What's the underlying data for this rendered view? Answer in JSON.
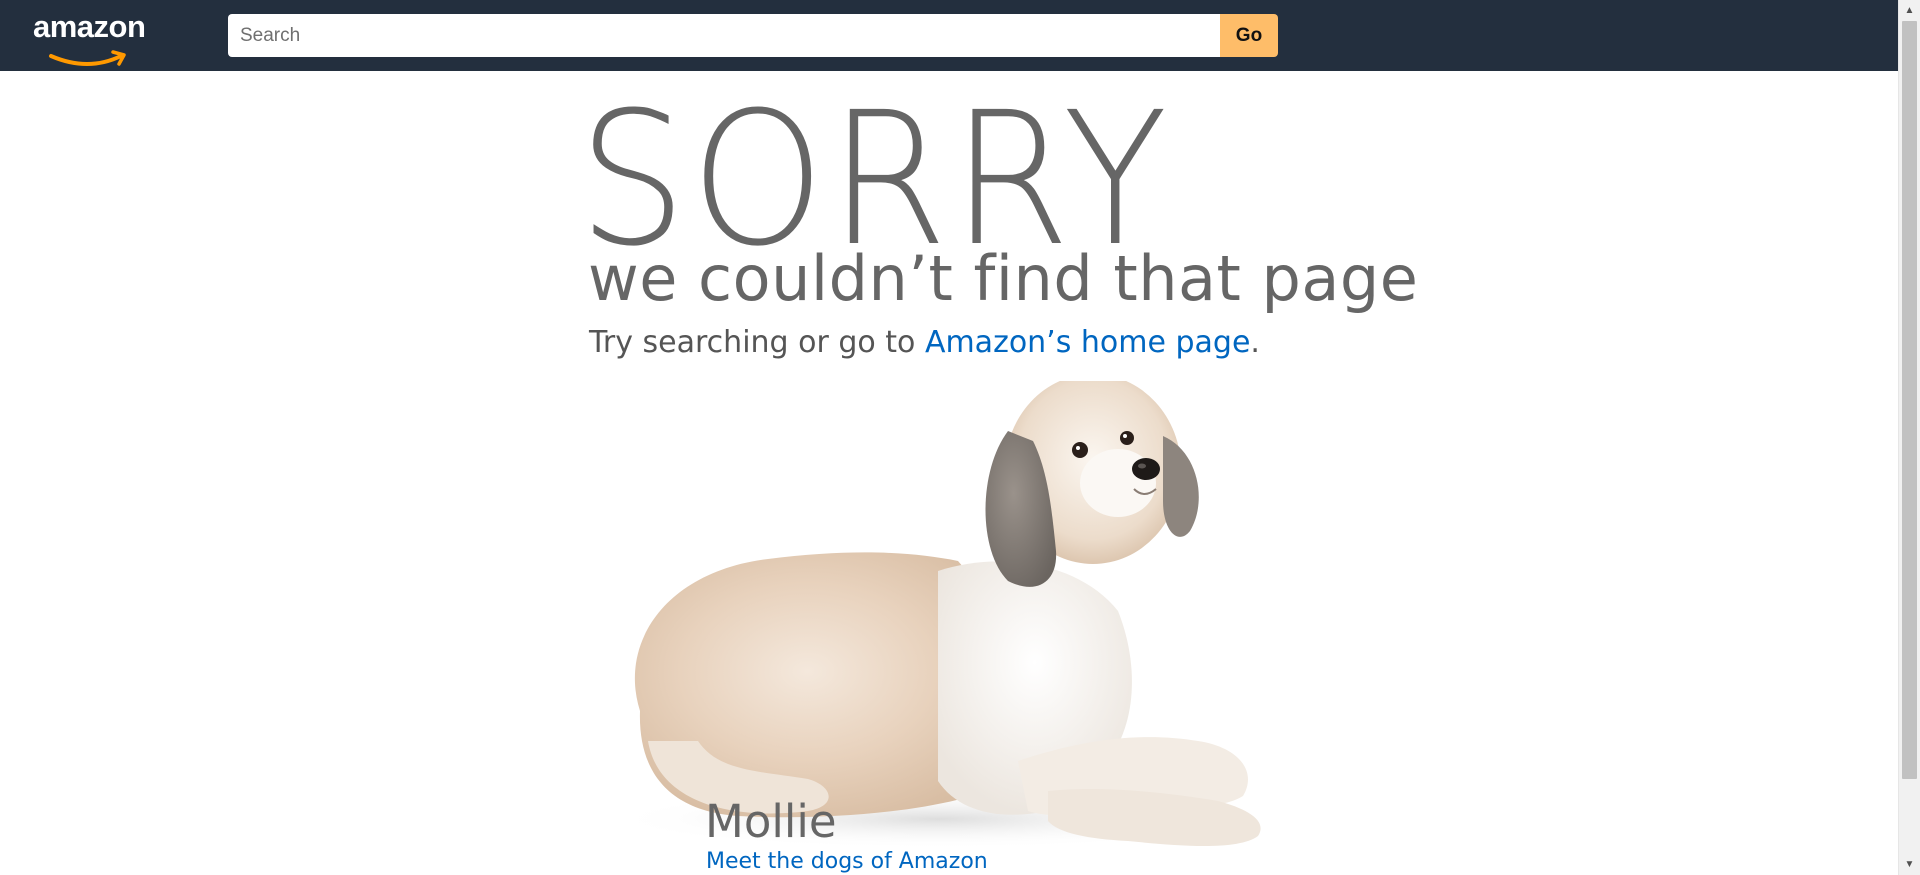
{
  "header": {
    "logo_text": "amazon",
    "search_placeholder": "Search",
    "search_value": "",
    "go_label": "Go",
    "colors": {
      "background": "#232f3e",
      "go_button": "#febd69",
      "logo_smile": "#ff9900"
    }
  },
  "error": {
    "title": "SORRY",
    "subtitle": "we couldn’t find that page",
    "try_prefix": "Try searching or go to ",
    "home_link": "Amazon’s home page",
    "try_suffix": "."
  },
  "dog": {
    "name": "Mollie",
    "link_text": "Meet the dogs of Amazon"
  },
  "icons": {
    "scroll_up": "▲",
    "scroll_down": "▼"
  },
  "colors": {
    "link": "#0066c0",
    "text_gray": "#666666"
  }
}
